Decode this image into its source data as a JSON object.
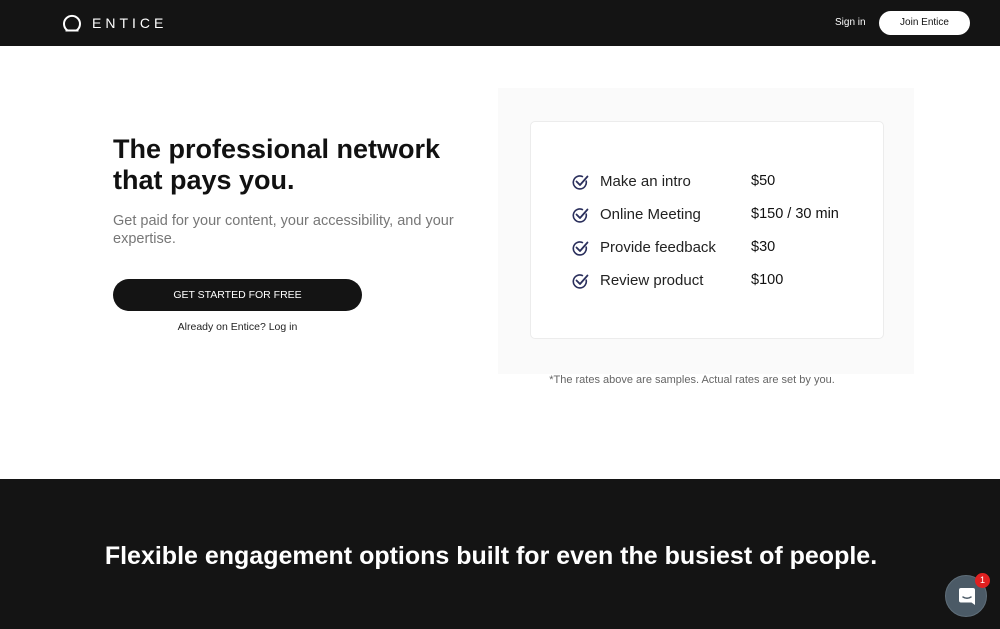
{
  "header": {
    "logo_text": "ENTICE",
    "signin_label": "Sign in",
    "join_label": "Join Entice"
  },
  "hero": {
    "headline_line1": "The professional network",
    "headline_line2": "that pays you.",
    "subtext": "Get paid for your content, your accessibility, and your expertise.",
    "cta_label": "GET STARTED FOR FREE",
    "login_text": "Already on Entice? Log in"
  },
  "rates": {
    "items": [
      {
        "label": "Make an intro",
        "price": "$50"
      },
      {
        "label": "Online Meeting",
        "price": "$150 / 30 min"
      },
      {
        "label": "Provide feedback",
        "price": "$30"
      },
      {
        "label": "Review product",
        "price": "$100"
      }
    ],
    "disclaimer": "*The rates above are samples. Actual rates are set by you."
  },
  "section2": {
    "heading": "Flexible engagement options built for even the busiest of people."
  },
  "chat": {
    "badge_count": "1",
    "icon": "chat-bubble-icon"
  },
  "colors": {
    "dark": "#141414",
    "check": "#2a2f5c",
    "badge": "#e02020"
  }
}
